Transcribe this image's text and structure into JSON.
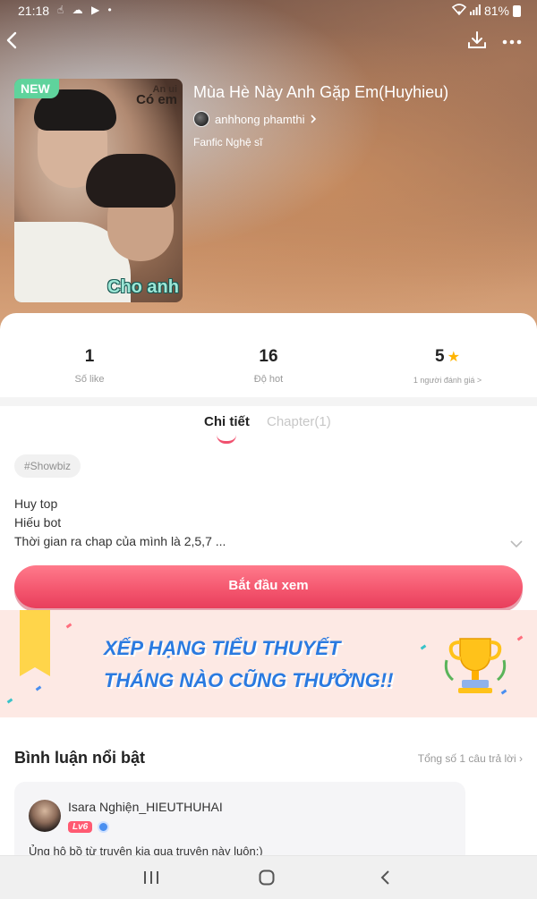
{
  "status_bar": {
    "time": "21:18",
    "battery": "81%"
  },
  "header": {
    "back_icon": "chevron-left-icon",
    "download_icon": "download-icon",
    "more_icon": "more-dots-icon"
  },
  "book": {
    "badge": "NEW",
    "cover_text_1": "An ui",
    "cover_text_2": "Có em",
    "cover_text_3": "Cho anh",
    "title": "Mùa Hè Này Anh Gặp Em(Huyhieu)",
    "author": "anhhong phamthi",
    "category": "Fanfic Nghệ sĩ"
  },
  "stats": {
    "likes": {
      "value": "1",
      "label": "Số like"
    },
    "hot": {
      "value": "16",
      "label": "Độ hot"
    },
    "rating": {
      "value": "5",
      "label": "1 người đánh giá >"
    }
  },
  "tabs": {
    "detail": "Chi tiết",
    "chapter": "Chapter(1)"
  },
  "tag": "#Showbiz",
  "description": {
    "line1": "Huy top",
    "line2": "Hiếu bot",
    "line3": "Thời gian ra chap của mình là 2,5,7 ..."
  },
  "start_button": "Bắt đầu xem",
  "banner": {
    "line1": "XẾP HẠNG TIỂU THUYẾT",
    "line2": "THÁNG NÀO CŨNG THƯỞNG!!"
  },
  "comments": {
    "heading": "Bình luận nổi bật",
    "total": "Tổng số 1 câu trả lời",
    "items": [
      {
        "name": "Isara Nghiện_HIEUTHUHAI",
        "level": "Lv6",
        "text": "Ủng hộ bồ từ truyện kia qua truyện này luôn:)"
      }
    ]
  },
  "colors": {
    "accent": "#f3546d",
    "badge_green": "#5fd39c",
    "banner_blue": "#2a7ae0"
  }
}
